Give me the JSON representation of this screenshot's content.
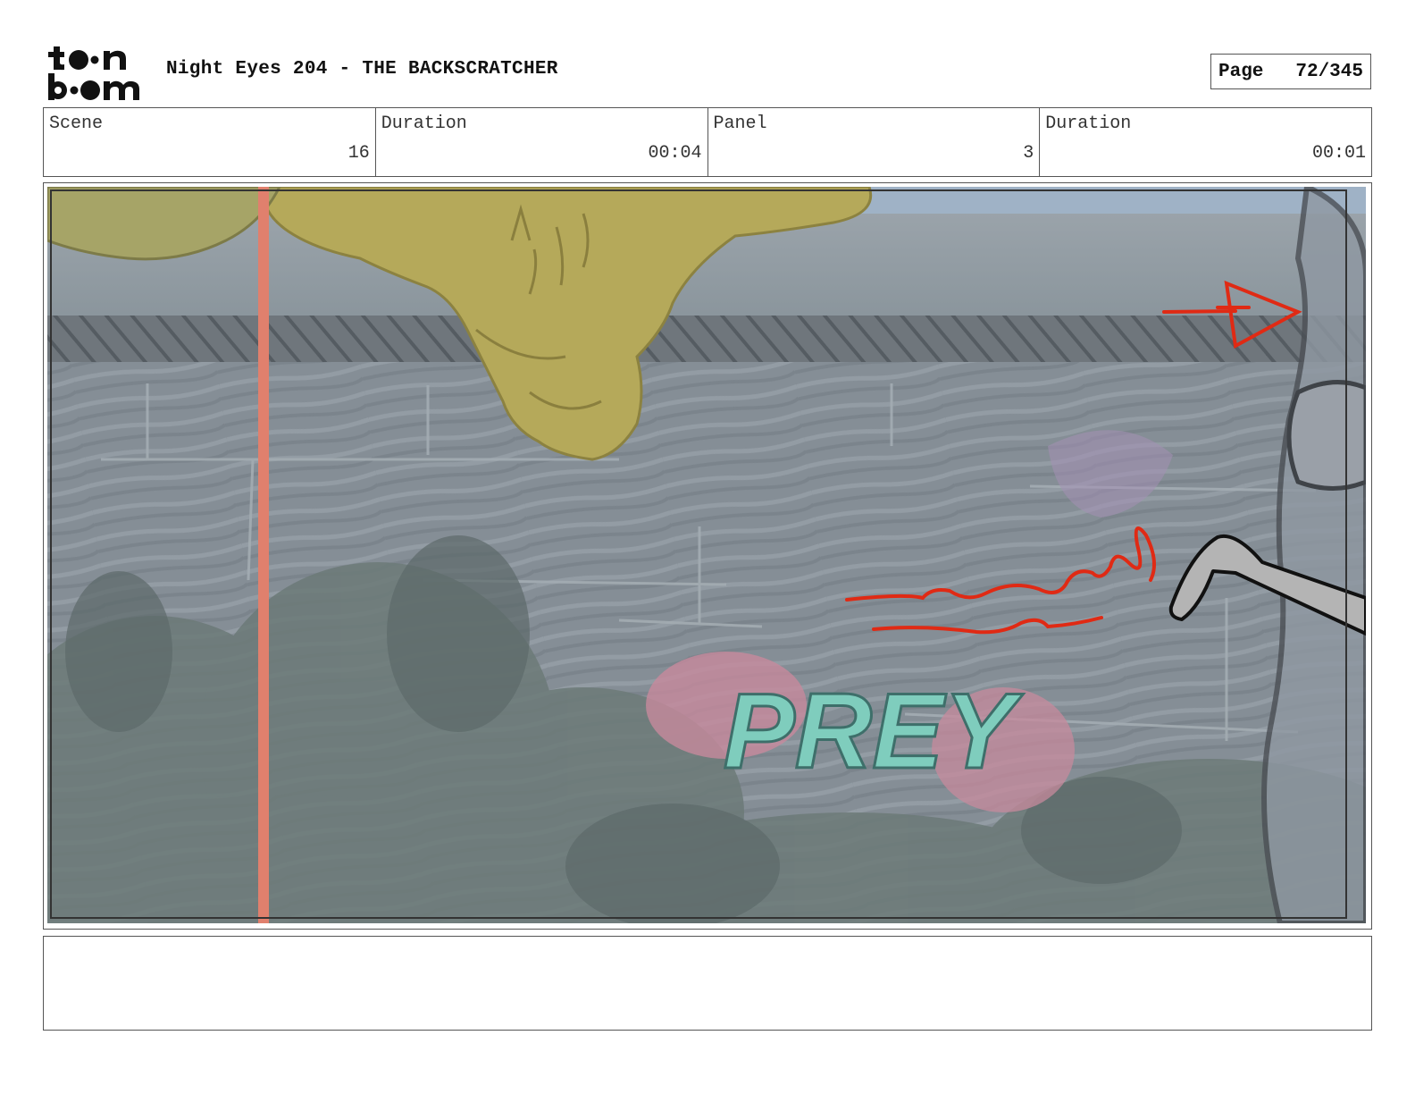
{
  "header": {
    "logo_alt": "toon boom",
    "title": "Night Eyes 204 - THE BACKSCRATCHER",
    "page_label": "Page",
    "page_number": "72/345"
  },
  "info": {
    "scene_label": "Scene",
    "scene_value": "16",
    "scene_duration_label": "Duration",
    "scene_duration_value": "00:04",
    "panel_label": "Panel",
    "panel_value": "3",
    "panel_duration_label": "Duration",
    "panel_duration_value": "00:01"
  },
  "panel": {
    "graffiti_text": "PREY"
  },
  "notes": {
    "text": ""
  }
}
